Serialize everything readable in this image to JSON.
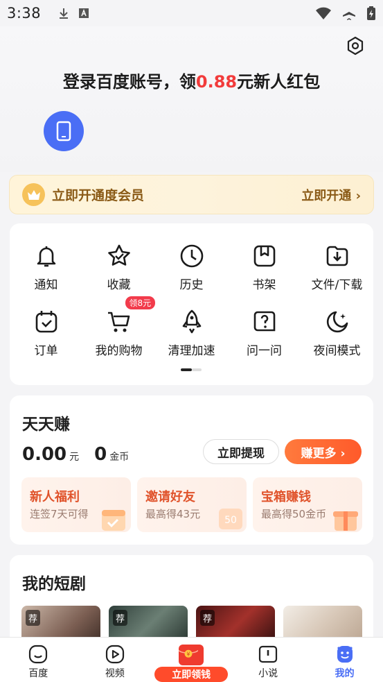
{
  "status_bar": {
    "time": "3:38"
  },
  "header": {
    "login_prefix": "登录百度账号，领",
    "login_amount": "0.88",
    "login_suffix": "元新人红包"
  },
  "vip": {
    "title": "立即开通度会员",
    "action": "立即开通 ›"
  },
  "grid": {
    "row1": [
      {
        "label": "通知",
        "icon": "bell-icon"
      },
      {
        "label": "收藏",
        "icon": "star-icon"
      },
      {
        "label": "历史",
        "icon": "clock-icon"
      },
      {
        "label": "书架",
        "icon": "bookshelf-icon"
      },
      {
        "label": "文件/下载",
        "icon": "download-icon"
      }
    ],
    "row2": [
      {
        "label": "订单",
        "icon": "order-icon"
      },
      {
        "label": "我的购物",
        "icon": "cart-icon",
        "badge": "领8元"
      },
      {
        "label": "清理加速",
        "icon": "rocket-icon"
      },
      {
        "label": "问一问",
        "icon": "question-icon"
      },
      {
        "label": "夜间模式",
        "icon": "moon-icon"
      }
    ]
  },
  "earn": {
    "title": "天天赚",
    "cash_value": "0.00",
    "cash_unit": "元",
    "coin_value": "0",
    "coin_unit": "金币",
    "withdraw_label": "立即提现",
    "more_label": "赚更多 ›",
    "tasks": [
      {
        "title": "新人福利",
        "subtitle": "连签7天可得"
      },
      {
        "title": "邀请好友",
        "subtitle": "最高得43元"
      },
      {
        "title": "宝箱赚钱",
        "subtitle": "最高得50金币"
      }
    ]
  },
  "drama": {
    "title": "我的短剧",
    "tag": "荐"
  },
  "tabs": [
    {
      "label": "百度"
    },
    {
      "label": "视频"
    },
    {
      "label": "立即领钱"
    },
    {
      "label": "小说"
    },
    {
      "label": "我的"
    }
  ],
  "colors": {
    "accent": "#4a6ef5",
    "red": "#f23b3b",
    "orange": "#ff5a2a",
    "gold": "#8a5a16"
  }
}
